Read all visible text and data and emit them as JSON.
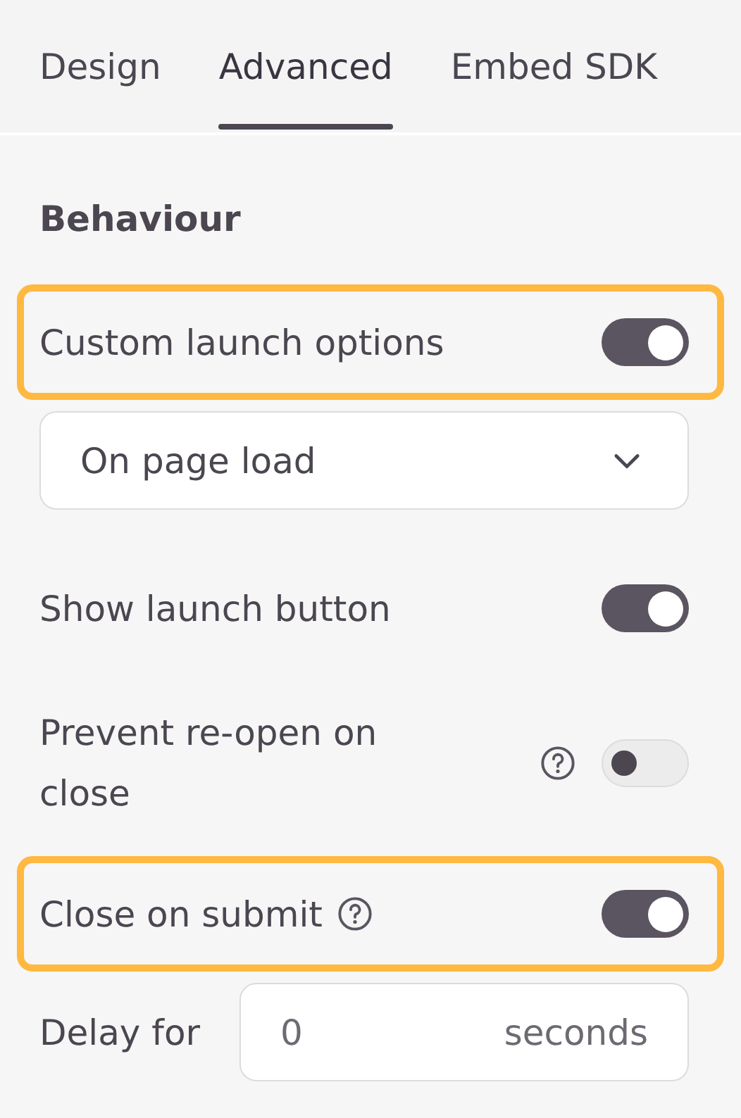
{
  "tabs": [
    {
      "label": "Design",
      "selected": false
    },
    {
      "label": "Advanced",
      "selected": true
    },
    {
      "label": "Embed SDK",
      "selected": false
    }
  ],
  "section_title": "Behaviour",
  "settings": [
    {
      "kind": "toggle",
      "label": "Custom launch options",
      "on": true,
      "highlighted": true
    },
    {
      "kind": "dropdown",
      "value": "On page load"
    },
    {
      "kind": "toggle",
      "label": "Show launch button",
      "on": true,
      "highlighted": false
    },
    {
      "kind": "toggle",
      "label": "Prevent re-open on close",
      "on": false,
      "help_before_toggle": true,
      "highlighted": false
    },
    {
      "kind": "toggle",
      "label": "Close on submit",
      "on": true,
      "help_after_label": true,
      "highlighted": true
    },
    {
      "kind": "number",
      "label": "Delay for",
      "value": "0",
      "suffix": "seconds"
    }
  ]
}
